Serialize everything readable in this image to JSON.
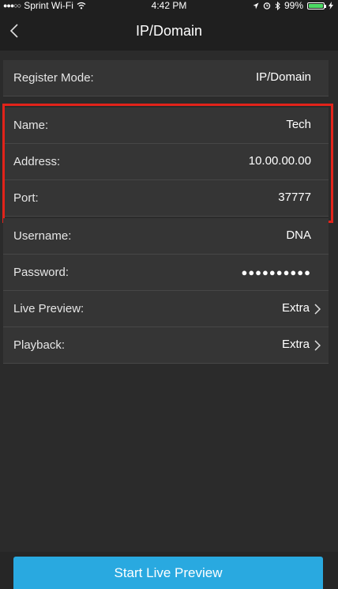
{
  "status_bar": {
    "carrier": "Sprint Wi-Fi",
    "time": "4:42 PM",
    "battery": "99%",
    "battery_level": 0.99,
    "battery_color": "#4cd964",
    "icons": [
      "signal-dots-icon",
      "wifi-icon",
      "location-arrow-icon",
      "alarm-icon",
      "bluetooth-icon",
      "battery-icon",
      "charging-bolt-icon"
    ]
  },
  "nav": {
    "title": "IP/Domain",
    "back_icon": "chevron-left-icon"
  },
  "register": {
    "label": "Register Mode:",
    "value": "IP/Domain"
  },
  "device": {
    "name": {
      "label": "Name:",
      "value": "Tech"
    },
    "address": {
      "label": "Address:",
      "value": "10.00.00.00"
    },
    "port": {
      "label": "Port:",
      "value": "37777"
    }
  },
  "credentials": {
    "username": {
      "label": "Username:",
      "value": "DNA"
    },
    "password": {
      "label": "Password:",
      "value": "●●●●●●●●●●"
    }
  },
  "stream": {
    "live_preview": {
      "label": "Live Preview:",
      "value": "Extra"
    },
    "playback": {
      "label": "Playback:",
      "value": "Extra"
    }
  },
  "actions": {
    "start_live_preview": "Start Live Preview",
    "button_color": "#29a9e0"
  },
  "highlight_color": "#e2231a"
}
